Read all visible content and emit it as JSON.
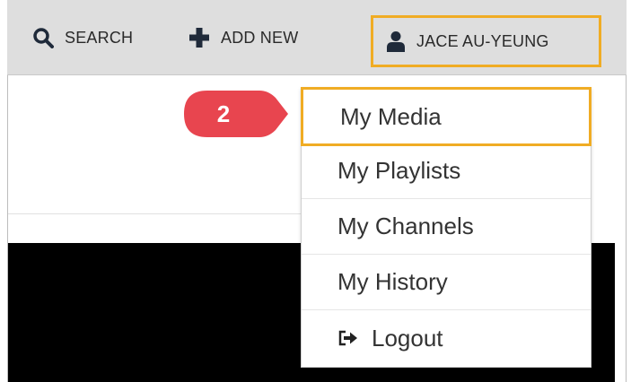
{
  "header": {
    "search_label": "SEARCH",
    "add_new_label": "ADD NEW",
    "user_label": "JACE AU-YEUNG"
  },
  "menu": {
    "items": [
      {
        "label": "My Media"
      },
      {
        "label": "My Playlists"
      },
      {
        "label": "My Channels"
      },
      {
        "label": "My History"
      },
      {
        "label": "Logout",
        "icon": "logout-icon"
      }
    ]
  },
  "callout": {
    "number": "2"
  },
  "colors": {
    "highlight": "#f0ac24",
    "callout": "#e8454f",
    "topbar": "#dedede",
    "icon": "#1f2a3a"
  }
}
